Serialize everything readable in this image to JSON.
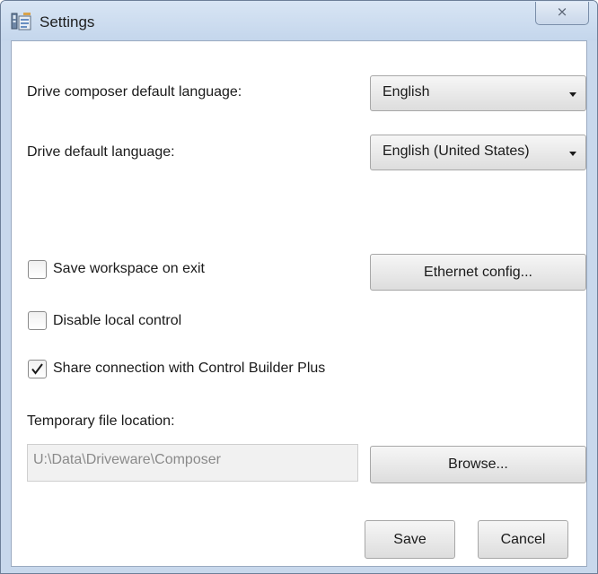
{
  "window": {
    "title": "Settings",
    "close_glyph": "⨯"
  },
  "settings": {
    "composer_language_label": "Drive composer default language:",
    "composer_language_value": "English",
    "drive_language_label": "Drive default language:",
    "drive_language_value": "English (United States)",
    "save_workspace_label": "Save workspace on exit",
    "save_workspace_checked": false,
    "ethernet_button": "Ethernet config...",
    "disable_local_label": "Disable local control",
    "disable_local_checked": false,
    "share_connection_label": "Share connection with Control Builder Plus",
    "share_connection_checked": true,
    "temp_location_label": "Temporary file location:",
    "temp_location_value": "U:\\Data\\Driveware\\Composer",
    "browse_button": "Browse..."
  },
  "footer": {
    "save_button": "Save",
    "cancel_button": "Cancel"
  },
  "icons": {
    "app": "settings-app-icon",
    "close": "close-icon",
    "dropdown": "chevron-down-icon",
    "check": "checkmark-icon"
  }
}
